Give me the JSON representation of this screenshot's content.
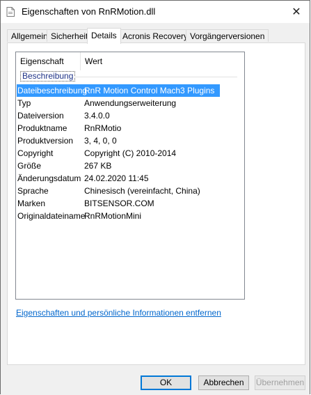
{
  "window": {
    "title": "Eigenschaften von RnRMotion.dll",
    "close_glyph": "✕"
  },
  "tabs": [
    {
      "label": "Allgemein"
    },
    {
      "label": "Sicherheit"
    },
    {
      "label": "Details"
    },
    {
      "label": "Acronis Recovery"
    },
    {
      "label": "Vorgängerversionen"
    }
  ],
  "active_tab": "Details",
  "list": {
    "col_property": "Eigenschaft",
    "col_value": "Wert",
    "group": "Beschreibung",
    "rows": [
      {
        "key": "Dateibeschreibung",
        "value": "RnR Motion Control Mach3 Plugins"
      },
      {
        "key": "Typ",
        "value": "Anwendungserweiterung"
      },
      {
        "key": "Dateiversion",
        "value": "3.4.0.0"
      },
      {
        "key": "Produktname",
        "value": "RnRMotio"
      },
      {
        "key": "Produktversion",
        "value": "3, 4, 0, 0"
      },
      {
        "key": "Copyright",
        "value": "Copyright (C) 2010-2014"
      },
      {
        "key": "Größe",
        "value": "267 KB"
      },
      {
        "key": "Änderungsdatum",
        "value": "24.02.2020 11:45"
      },
      {
        "key": "Sprache",
        "value": "Chinesisch (vereinfacht, China)"
      },
      {
        "key": "Marken",
        "value": "BITSENSOR.COM"
      },
      {
        "key": "Originaldateiname",
        "value": "RnRMotionMini"
      }
    ]
  },
  "link": {
    "label": "Eigenschaften und persönliche Informationen entfernen"
  },
  "buttons": {
    "ok": "OK",
    "cancel": "Abbrechen",
    "apply": "Übernehmen"
  },
  "colors": {
    "selection": "#3399ff",
    "link": "#0066cc"
  }
}
